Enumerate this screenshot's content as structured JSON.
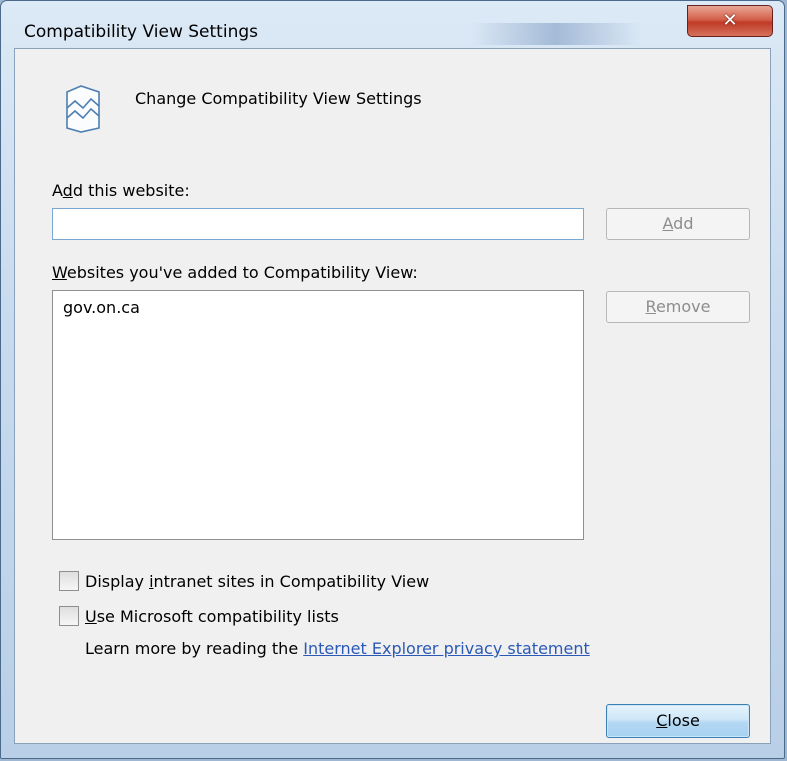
{
  "window": {
    "title": "Compatibility View Settings",
    "close_glyph": "✕"
  },
  "header": {
    "icon": "compatibility-view-icon",
    "text": "Change Compatibility View Settings"
  },
  "add_section": {
    "label_pre": "A",
    "label_accel": "d",
    "label_post": "d this website:",
    "input_value": "",
    "add_button_accel": "A",
    "add_button_post": "dd"
  },
  "list_section": {
    "label_accel": "W",
    "label_post": "ebsites you've added to Compatibility View:",
    "items": [
      "gov.on.ca"
    ],
    "remove_button_accel": "R",
    "remove_button_post": "emove"
  },
  "options": {
    "intranet_pre": "Display ",
    "intranet_accel": "i",
    "intranet_post": "ntranet sites in Compatibility View",
    "intranet_checked": false,
    "mslists_accel": "U",
    "mslists_post": "se Microsoft compatibility lists",
    "mslists_checked": false,
    "learn_more_text": "Learn more by reading the ",
    "privacy_link": "Internet Explorer privacy statement"
  },
  "footer": {
    "close_accel": "C",
    "close_post": "lose"
  },
  "colors": {
    "link": "#2a59b7",
    "dialog_bg": "#f0f0f0",
    "frame": "#c9dbee"
  }
}
